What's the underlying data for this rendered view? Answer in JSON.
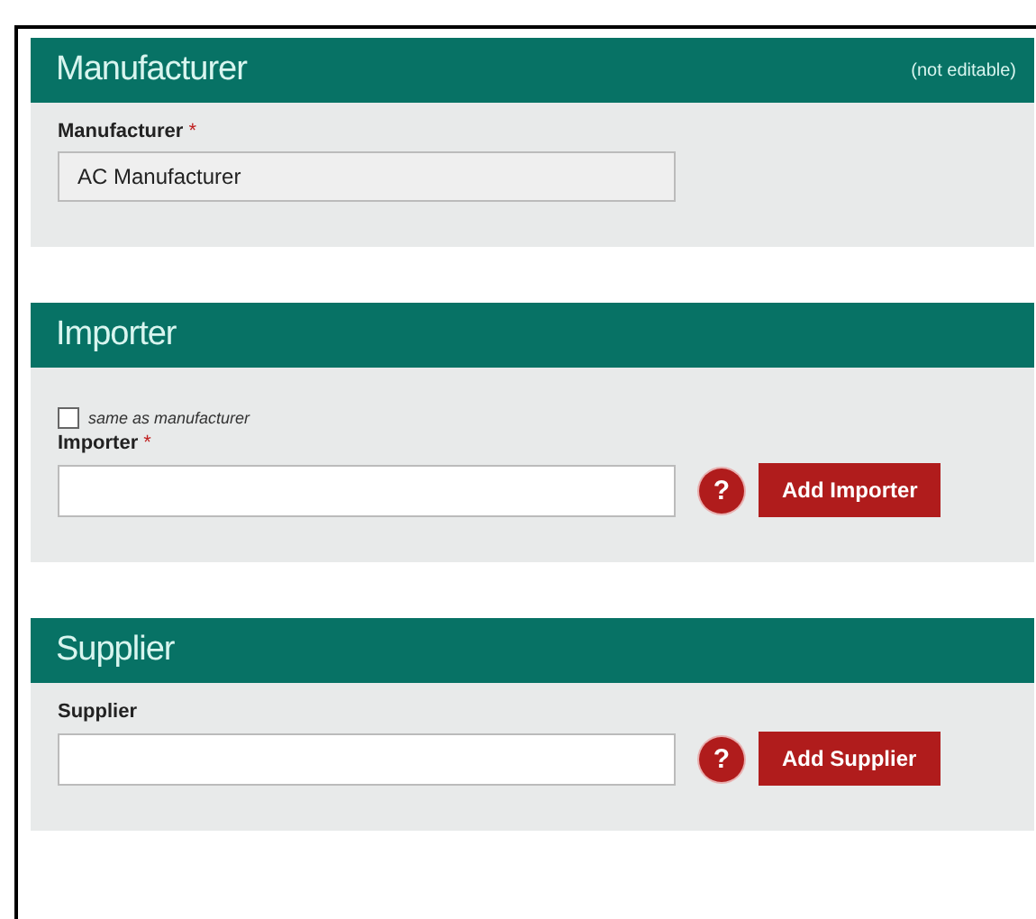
{
  "sections": [
    {
      "title": "Manufacturer",
      "note": "(not editable)",
      "fields": [
        {
          "kind": "readonly",
          "label": "Manufacturer",
          "required_mark": "*",
          "value": "AC Manufacturer"
        }
      ]
    },
    {
      "title": "Importer",
      "fields": [
        {
          "kind": "checkbox",
          "label": "same as manufacturer",
          "checked": false
        },
        {
          "kind": "lookup",
          "label": "Importer",
          "required_mark": "*",
          "help": "?",
          "button": "Add Importer"
        }
      ]
    },
    {
      "title": "Supplier",
      "fields": [
        {
          "kind": "lookup",
          "label": "Supplier",
          "help": "?",
          "button": "Add Supplier"
        }
      ]
    }
  ]
}
